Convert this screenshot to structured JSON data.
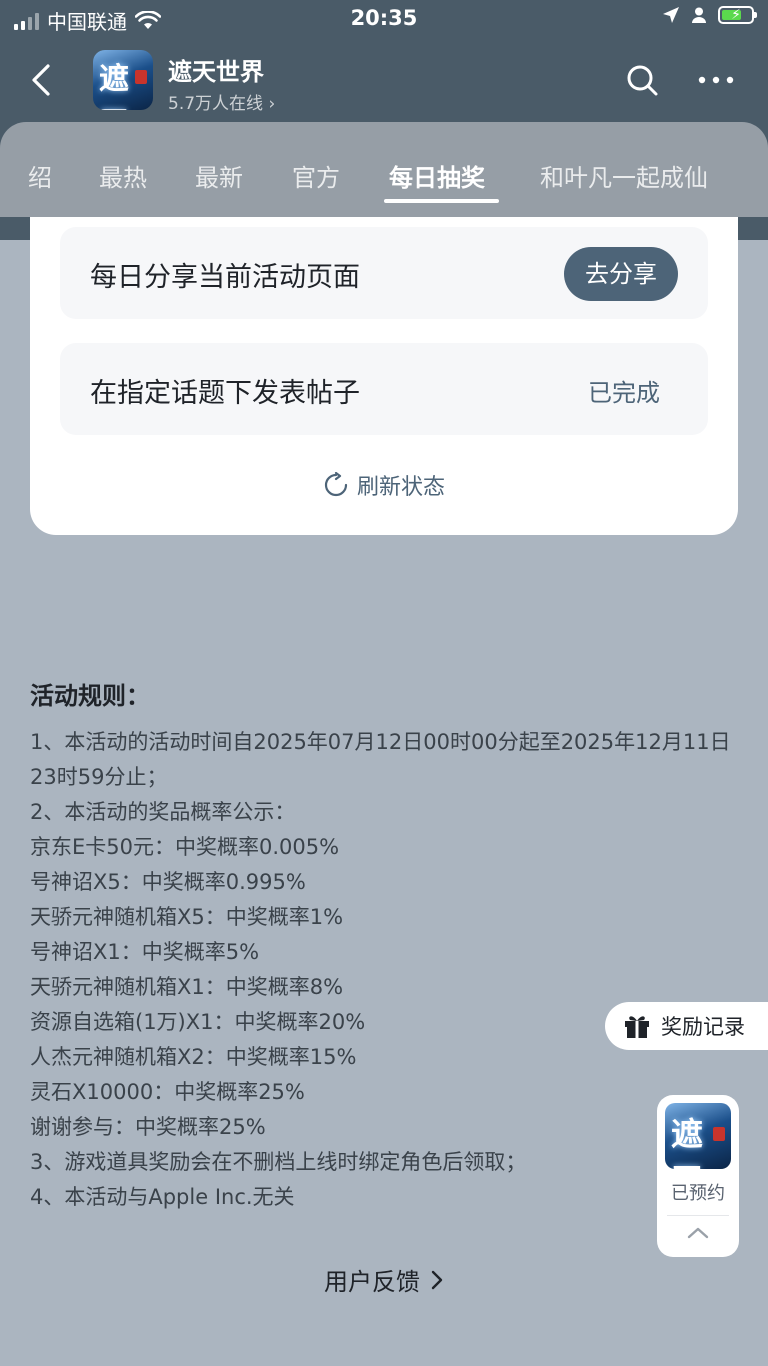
{
  "status_bar": {
    "carrier": "中国联通",
    "time": "20:35"
  },
  "header": {
    "app_name": "遮天世界",
    "online": "5.7万人在线",
    "icon_glyph": "遮天"
  },
  "tabs": [
    {
      "label": "绍"
    },
    {
      "label": "最热"
    },
    {
      "label": "最新"
    },
    {
      "label": "官方"
    },
    {
      "label": "每日抽奖",
      "active": true
    },
    {
      "label": "和叶凡一起成仙"
    }
  ],
  "tasks": [
    {
      "label": "每日分享当前活动页面",
      "action": "去分享"
    },
    {
      "label": "在指定话题下发表帖子",
      "status": "已完成"
    }
  ],
  "refresh_label": "刷新状态",
  "rules": {
    "title": "活动规则：",
    "lines": [
      "1、本活动的活动时间自2025年07月12日00时00分起至2025年12月11日23时59分止；",
      "2、本活动的奖品概率公示：",
      "京东E卡50元：中奖概率0.005%",
      "号神诏X5：中奖概率0.995%",
      "天骄元神随机箱X5：中奖概率1%",
      "号神诏X1：中奖概率5%",
      "天骄元神随机箱X1：中奖概率8%",
      "资源自选箱(1万)X1：中奖概率20%",
      "人杰元神随机箱X2：中奖概率15%",
      "灵石X10000：中奖概率25%",
      "谢谢参与：中奖概率25%",
      "3、游戏道具奖励会在不删档上线时绑定角色后领取；",
      "4、本活动与Apple Inc.无关"
    ]
  },
  "feedback_label": "用户反馈",
  "reward_float": {
    "label": "奖励记录"
  },
  "reserve_float": {
    "label": "已预约"
  },
  "colors": {
    "header_bg": "#4a5b68",
    "page_bg": "#abb5c0",
    "accent": "#4d6478",
    "battery_green": "#5bd94d"
  }
}
